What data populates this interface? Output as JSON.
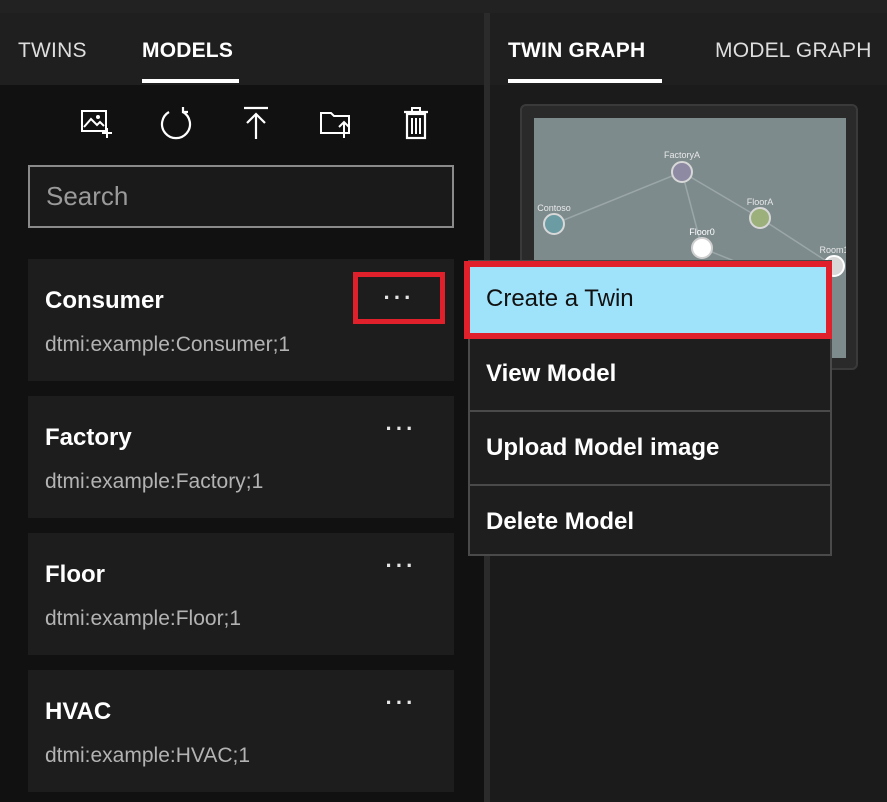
{
  "left_tabs": [
    {
      "label": "TWINS",
      "active": false
    },
    {
      "label": "MODELS",
      "active": true
    }
  ],
  "toolbar": {
    "items": [
      {
        "icon": "upload-model-image-icon"
      },
      {
        "icon": "refresh-icon"
      },
      {
        "icon": "upload-icon"
      },
      {
        "icon": "upload-folder-icon"
      },
      {
        "icon": "delete-icon"
      }
    ]
  },
  "search": {
    "placeholder": "Search",
    "value": ""
  },
  "models": [
    {
      "name": "Consumer",
      "id": "dtmi:example:Consumer;1",
      "more": "···"
    },
    {
      "name": "Factory",
      "id": "dtmi:example:Factory;1",
      "more": "···"
    },
    {
      "name": "Floor",
      "id": "dtmi:example:Floor;1",
      "more": "···"
    },
    {
      "name": "HVAC",
      "id": "dtmi:example:HVAC;1",
      "more": "···"
    }
  ],
  "right_tabs": [
    {
      "label": "TWIN GRAPH",
      "active": true
    },
    {
      "label": "MODEL GRAPH",
      "active": false
    }
  ],
  "graph_preview": {
    "nodes": [
      {
        "label": "FactoryA"
      },
      {
        "label": "Contoso"
      },
      {
        "label": "FloorA"
      },
      {
        "label": "Floor0"
      },
      {
        "label": "Room1"
      }
    ]
  },
  "context_menu": {
    "items": [
      {
        "label": "Create a Twin",
        "selected": true
      },
      {
        "label": "View Model",
        "selected": false
      },
      {
        "label": "Upload Model image",
        "selected": false
      },
      {
        "label": "Delete Model",
        "selected": false
      }
    ]
  },
  "colors": {
    "accent_highlight": "#e0202a",
    "menu_selected": "#9fe3fb",
    "panel_bg": "#111111",
    "card_bg": "#1d1d1d"
  }
}
